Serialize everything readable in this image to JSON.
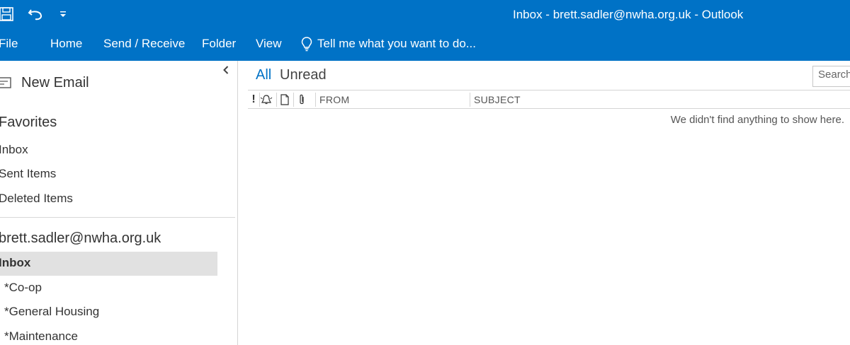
{
  "window": {
    "title": "Inbox - brett.sadler@nwha.org.uk - Outlook"
  },
  "colors": {
    "brand": "#0072c6",
    "selected_folder_bg": "#e1e1e1"
  },
  "quick_access": {
    "icons": [
      "save-icon",
      "undo-icon",
      "customize-toolbar-icon"
    ]
  },
  "ribbon": {
    "tabs": [
      {
        "label": "File"
      },
      {
        "label": "Home"
      },
      {
        "label": "Send / Receive"
      },
      {
        "label": "Folder"
      },
      {
        "label": "View"
      }
    ],
    "tell_me": "Tell me what you want to do..."
  },
  "folder_pane": {
    "new_email": "New Email",
    "favorites": {
      "heading": "Favorites",
      "items": [
        "Inbox",
        "Sent Items",
        "Deleted Items"
      ]
    },
    "account": {
      "heading": "brett.sadler@nwha.org.uk",
      "selected": "Inbox",
      "subfolders": [
        "*Co-op",
        "*General Housing",
        "*Maintenance"
      ]
    }
  },
  "message_list": {
    "filters": {
      "all": "All",
      "unread": "Unread",
      "active": "All"
    },
    "search_placeholder": "Search Current Mailbox",
    "columns": {
      "from": "FROM",
      "subject": "SUBJECT"
    },
    "empty_text": "We didn't find anything to show here."
  }
}
